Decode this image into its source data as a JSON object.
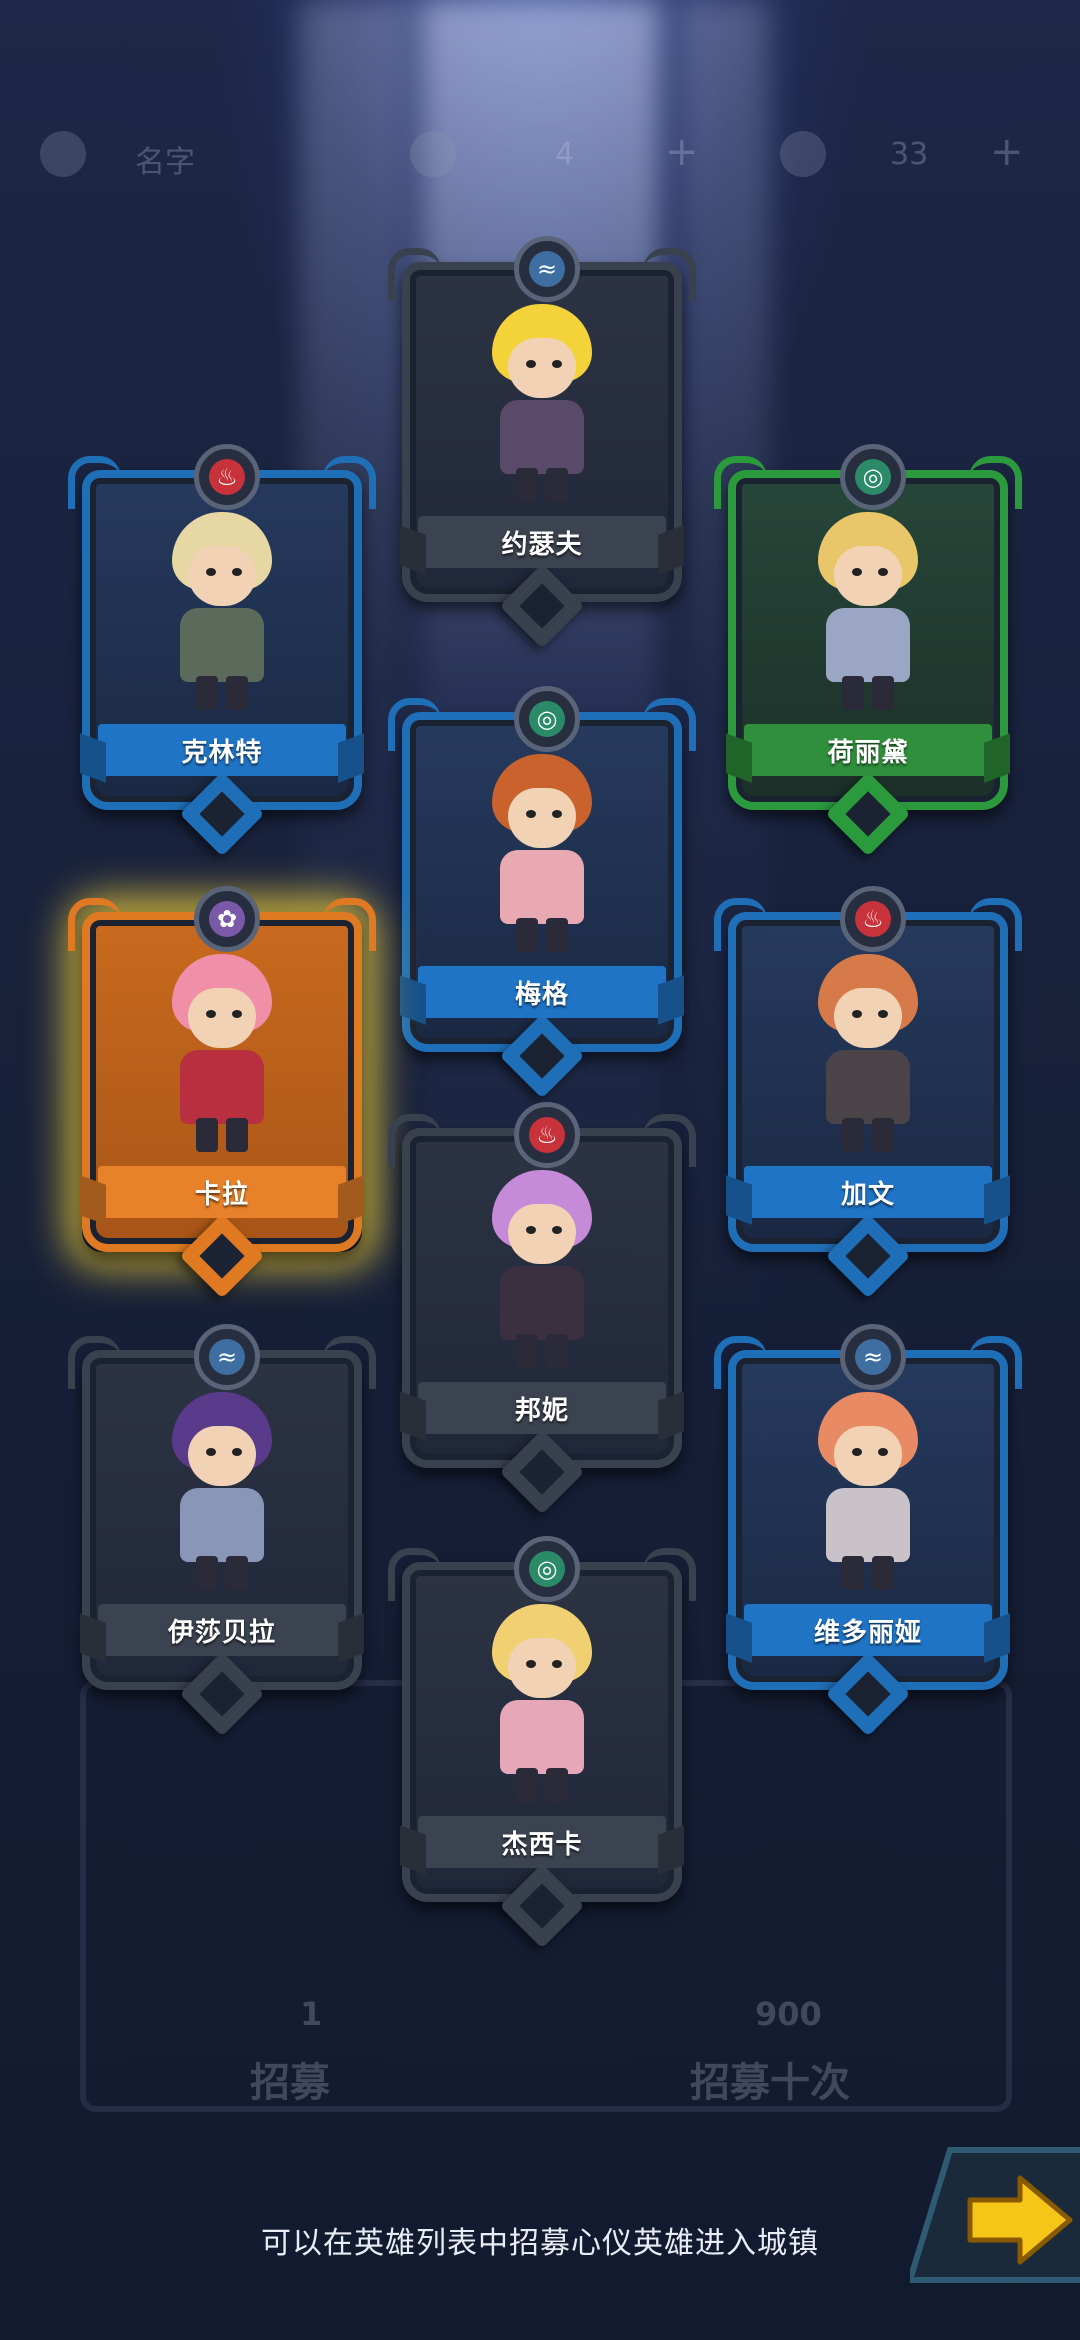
{
  "topbar": {
    "name_label": "名字",
    "value_a": "4",
    "value_b": "33"
  },
  "recruit": {
    "single_cost": "1",
    "single_label": "招募",
    "ten_cost": "900",
    "ten_label": "招募十次"
  },
  "heroes": [
    {
      "name": "约瑟夫",
      "element": "water",
      "rarity": "gray"
    },
    {
      "name": "克林特",
      "element": "fire",
      "rarity": "blue"
    },
    {
      "name": "荷丽黛",
      "element": "wind",
      "rarity": "green"
    },
    {
      "name": "梅格",
      "element": "wind",
      "rarity": "blue"
    },
    {
      "name": "卡拉",
      "element": "light",
      "rarity": "orange",
      "selected": true
    },
    {
      "name": "加文",
      "element": "fire",
      "rarity": "blue"
    },
    {
      "name": "邦妮",
      "element": "fire",
      "rarity": "gray"
    },
    {
      "name": "伊莎贝拉",
      "element": "water",
      "rarity": "gray"
    },
    {
      "name": "维多丽娅",
      "element": "water",
      "rarity": "blue"
    },
    {
      "name": "杰西卡",
      "element": "wind",
      "rarity": "gray"
    }
  ],
  "hint_text": "可以在英雄列表中招募心仪英雄进入城镇",
  "colors": {
    "highlight_glow": "#ffdc3c",
    "next_button": "#f5c518"
  }
}
